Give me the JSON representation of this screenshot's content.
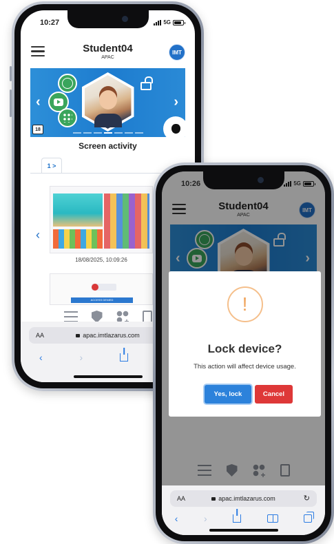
{
  "back_phone": {
    "status_time": "10:27",
    "network": "5G",
    "student_name": "Student04",
    "region": "APAC",
    "avatar_initials": "IMT",
    "age_badge": "18",
    "section_title": "Screen activity",
    "tab_label": "1 >",
    "screenshot_timestamp": "18/08/2025, 10:09:26",
    "screenshot2_button": "ACCESS DENIED",
    "url_aa": "AA",
    "url": "apac.imtlazarus.com"
  },
  "front_phone": {
    "status_time": "10:26",
    "network": "5G",
    "student_name": "Student04",
    "region": "APAC",
    "avatar_initials": "IMT",
    "url_aa": "AA",
    "url": "apac.imtlazarus.com",
    "modal": {
      "icon": "!",
      "title": "Lock device?",
      "message": "This action will affect device usage.",
      "confirm_label": "Yes, lock",
      "cancel_label": "Cancel"
    }
  },
  "colors": {
    "brand_blue": "#2271c8",
    "banner_blue": "#2d8fd8",
    "confirm_blue": "#2c82db",
    "cancel_red": "#de3838",
    "warning_orange": "#f0a45c",
    "safari_blue": "#2a7be2"
  },
  "icons": [
    "hamburger-icon",
    "avatar",
    "globe-icon",
    "video-icon",
    "apps-grid-icon",
    "unlock-icon",
    "apple-icon",
    "chevron-left-icon",
    "chevron-right-icon",
    "sliders-icon",
    "shield-icon",
    "add-apps-icon",
    "clipboard-icon",
    "lock-icon",
    "share-icon",
    "bookmarks-icon",
    "tabs-icon",
    "reload-icon",
    "warning-icon"
  ]
}
